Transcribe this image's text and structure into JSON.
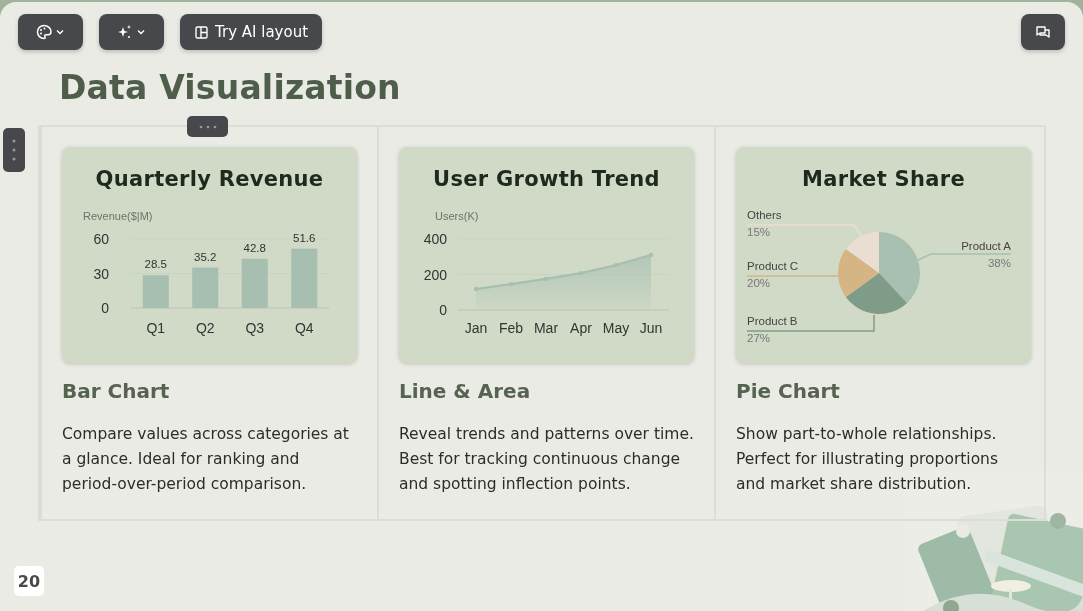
{
  "toolbar": {
    "layout_button": "Try AI layout"
  },
  "title": "Data Visualization",
  "cards": [
    {
      "chart_data": {
        "type": "bar",
        "title": "Quarterly Revenue",
        "ylabel": "Revenue($|M)",
        "categories": [
          "Q1",
          "Q2",
          "Q3",
          "Q4"
        ],
        "series": [
          {
            "color": "#a6bfb1",
            "values": [
              28.5,
              35.2,
              42.8,
              51.6
            ]
          }
        ],
        "ylim": [
          0,
          60
        ],
        "yticks": [
          0,
          30,
          60
        ],
        "data_labels": true
      },
      "heading": "Bar Chart",
      "description": "Compare values across categories at a glance. Ideal for ranking and period-over-period comparison."
    },
    {
      "chart_data": {
        "type": "area",
        "title": "User Growth Trend",
        "ylabel": "Users(K)",
        "categories": [
          "Jan",
          "Feb",
          "Mar",
          "Apr",
          "May",
          "Jun"
        ],
        "series": [
          {
            "color": "#a6bfb1",
            "values": [
              118,
              146,
              175,
              208,
              253,
              310
            ]
          }
        ],
        "ylim": [
          0,
          400
        ],
        "yticks": [
          0,
          200,
          400
        ]
      },
      "heading": "Line & Area",
      "description": "Reveal trends and patterns over time. Best for tracking continuous change and spotting inflection points."
    },
    {
      "chart_data": {
        "type": "pie",
        "title": "Market Share",
        "categories": [
          "Product A",
          "Product B",
          "Product C",
          "Others"
        ],
        "values": [
          38,
          27,
          20,
          15
        ],
        "colors": [
          "#a7c0b1",
          "#7f9c88",
          "#d6b584",
          "#eaddd1"
        ],
        "value_labels": [
          "38%",
          "27%",
          "20%",
          "15%"
        ]
      },
      "heading": "Pie Chart",
      "description": "Show part-to-whole relationships. Perfect for illustrating proportions and market share distribution."
    }
  ],
  "page_number": "20"
}
